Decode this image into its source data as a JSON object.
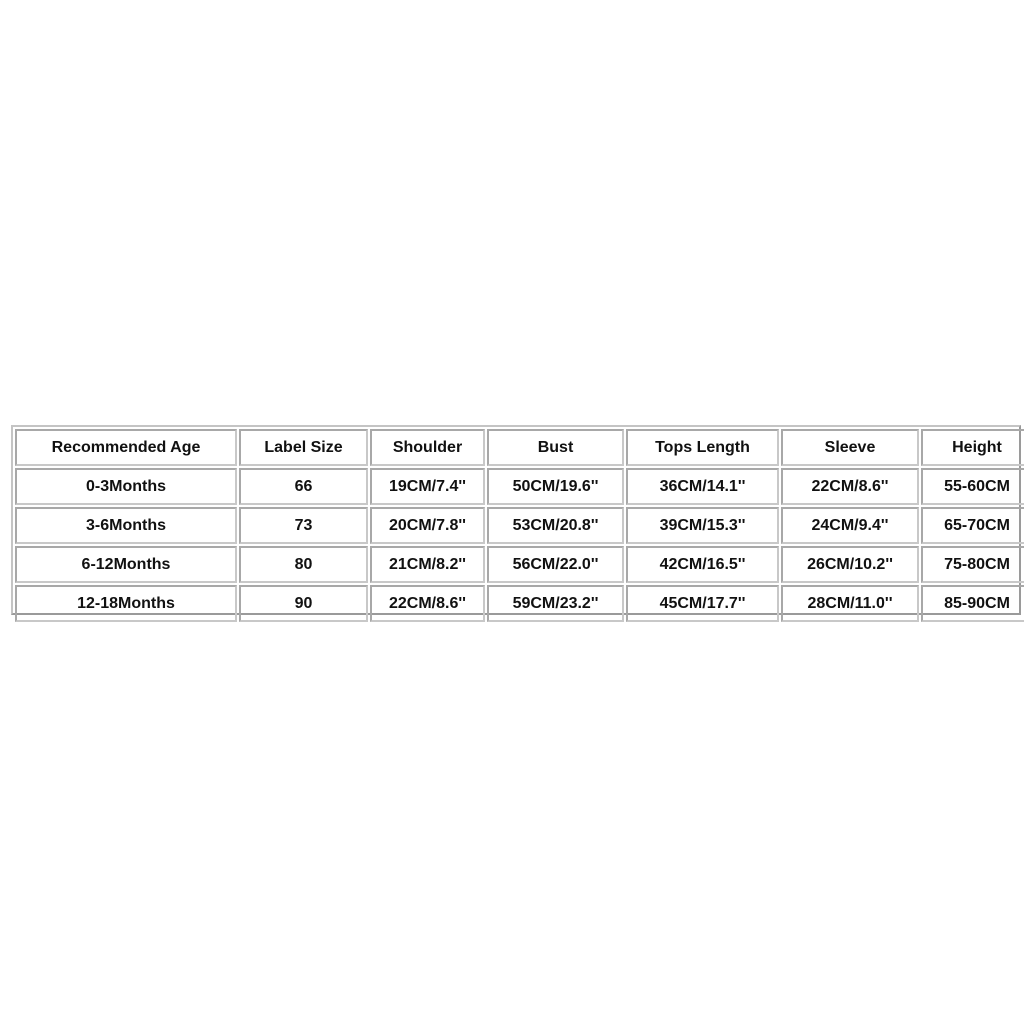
{
  "table": {
    "headers": [
      "Recommended Age",
      "Label Size",
      "Shoulder",
      "Bust",
      "Tops Length",
      "Sleeve",
      "Height"
    ],
    "rows": [
      [
        "0-3Months",
        "66",
        "19CM/7.4''",
        "50CM/19.6''",
        "36CM/14.1''",
        "22CM/8.6''",
        "55-60CM"
      ],
      [
        "3-6Months",
        "73",
        "20CM/7.8''",
        "53CM/20.8''",
        "39CM/15.3''",
        "24CM/9.4''",
        "65-70CM"
      ],
      [
        "6-12Months",
        "80",
        "21CM/8.2''",
        "56CM/22.0''",
        "42CM/16.5''",
        "26CM/10.2''",
        "75-80CM"
      ],
      [
        "12-18Months",
        "90",
        "22CM/8.6''",
        "59CM/23.2''",
        "45CM/17.7''",
        "28CM/11.0''",
        "85-90CM"
      ]
    ]
  }
}
